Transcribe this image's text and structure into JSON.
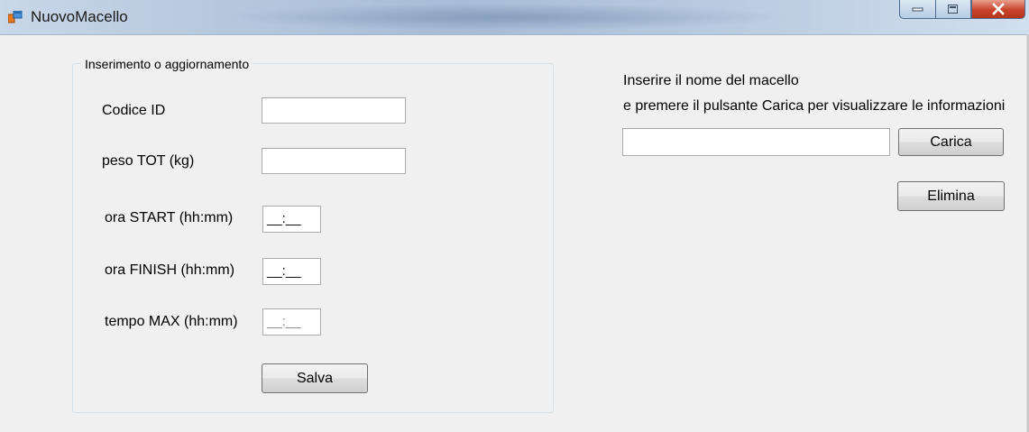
{
  "window": {
    "title": "NuovoMacello",
    "icons": {
      "app": "form-app-icon",
      "minimize": "minimize-icon",
      "maximize": "maximize-icon",
      "close": "close-icon"
    }
  },
  "group": {
    "legend": "Inserimento o aggiornamento",
    "fields": {
      "codice_id": {
        "label": "Codice ID",
        "value": ""
      },
      "peso_tot": {
        "label": "peso TOT (kg)",
        "value": ""
      },
      "ora_start": {
        "label": "ora START (hh:mm)",
        "mask": "__:__"
      },
      "ora_finish": {
        "label": "ora FINISH (hh:mm)",
        "mask": "__:__"
      },
      "tempo_max": {
        "label": "tempo MAX (hh:mm)",
        "mask": "__:__"
      }
    },
    "save_label": "Salva"
  },
  "lookup": {
    "line1": "Inserire il nome del macello",
    "line2": "e premere il pulsante Carica per visualizzare le informazioni",
    "name_value": "",
    "load_label": "Carica",
    "delete_label": "Elimina"
  }
}
